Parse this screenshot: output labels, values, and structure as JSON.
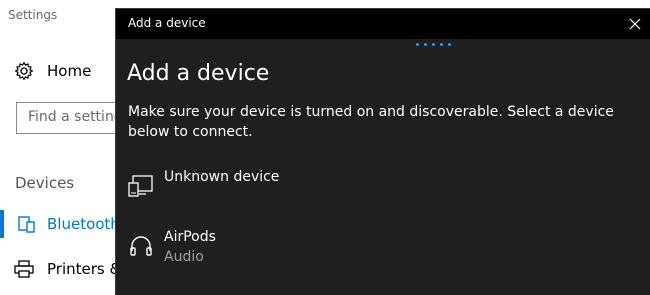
{
  "settings": {
    "title": "Settings",
    "home_label": "Home",
    "search_placeholder": "Find a setting",
    "section_heading": "Devices",
    "bluetooth_label": "Bluetooth",
    "printers_label": "Printers &",
    "accent_color": "#0078d7"
  },
  "dialog": {
    "titlebar": "Add a device",
    "heading": "Add a device",
    "description": "Make sure your device is turned on and discoverable. Select a device below to connect.",
    "progress_color": "#2b9af3",
    "devices": [
      {
        "name": "Unknown device",
        "subtitle": "",
        "icon": "display-icon"
      },
      {
        "name": "AirPods",
        "subtitle": "Audio",
        "icon": "headphones-icon"
      }
    ]
  }
}
